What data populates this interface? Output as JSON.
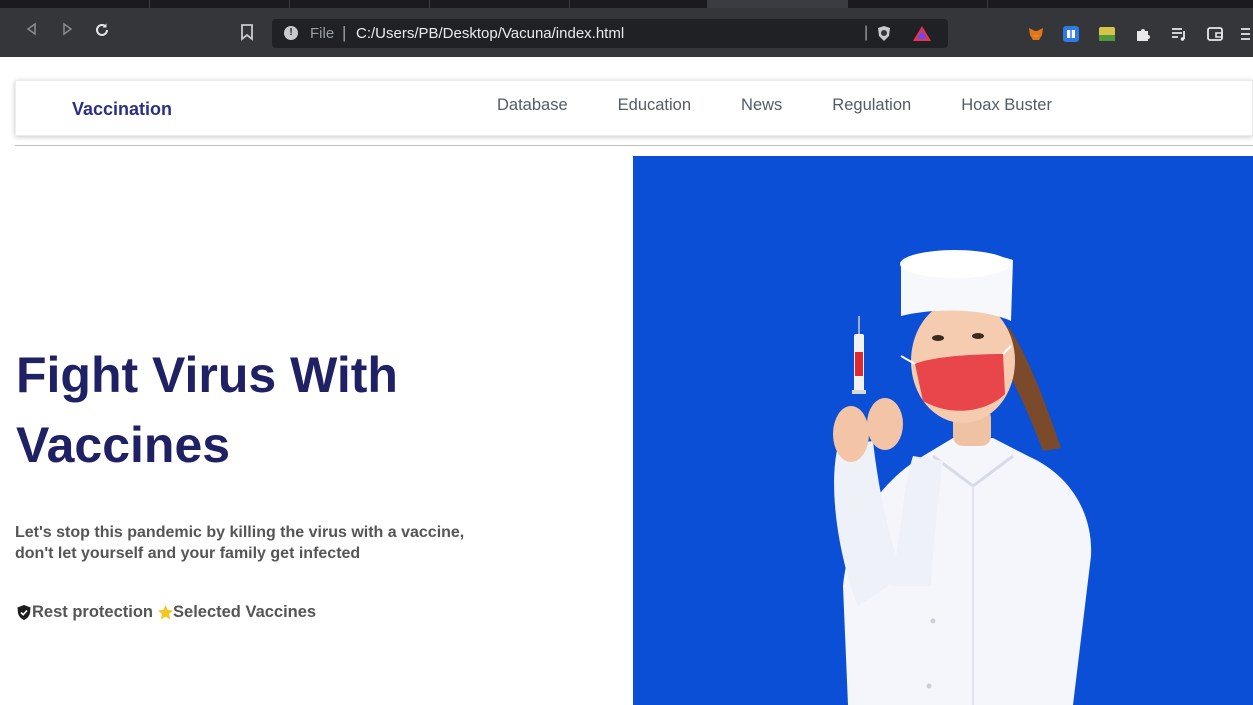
{
  "browser": {
    "scheme": "File",
    "separator": "|",
    "url": "C:/Users/PB/Desktop/Vacuna/index.html"
  },
  "navbar": {
    "brand": "Vaccination",
    "links": [
      "Database",
      "Education",
      "News",
      "Regulation",
      "Hoax Buster"
    ]
  },
  "hero": {
    "title": "Fight Virus With Vaccines",
    "subtitle": "Let's stop this pandemic by killing the virus with a vaccine, don't let yourself and your family get infected",
    "features": [
      {
        "icon": "shield-check-icon",
        "label": "Rest protection"
      },
      {
        "icon": "star-icon",
        "label": "Selected Vaccines"
      }
    ],
    "image_background": "#0a4fd6"
  },
  "colors": {
    "brand": "#2b2f86",
    "title": "#1f2164",
    "star": "#f3c623"
  }
}
